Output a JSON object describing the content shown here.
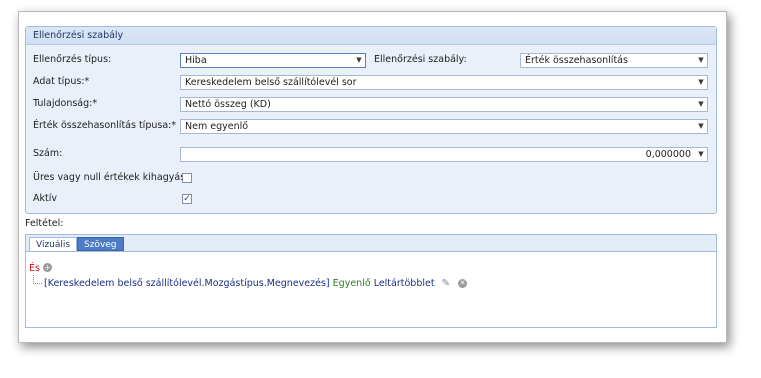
{
  "group": {
    "title": "Ellenőrzési szabály"
  },
  "form": {
    "ellenorzes_tipus": {
      "label": "Ellenőrzés típus:",
      "value": "Hiba"
    },
    "ellenorzesi_szabaly": {
      "label": "Ellenőrzési szabály:",
      "value": "Érték összehasonlítás"
    },
    "adat_tipus": {
      "label": "Adat típus:*",
      "value": "Kereskedelem belső szállítólevél sor"
    },
    "tulajdonsag": {
      "label": "Tulajdonság:*",
      "value": "Nettó összeg (KD)"
    },
    "osszehasonlitas_tipusa": {
      "label": "Érték összehasonlítás típusa:*",
      "value": "Nem egyenlő"
    },
    "szam": {
      "label": "Szám:",
      "value": "0,000000"
    },
    "ures_null": {
      "label": "Üres vagy null értékek kihagyása",
      "checked": false
    },
    "aktiv": {
      "label": "Aktív",
      "checked": true
    }
  },
  "condition": {
    "label": "Feltétel:",
    "tabs": [
      {
        "label": "Vizuális"
      },
      {
        "label": "Szöveg"
      }
    ],
    "group_operator": "És",
    "rule": {
      "field": "[Kereskedelem belső szállítólevél.Mozgástípus.Megnevezés]",
      "operator": "Egyenlő",
      "value": "Leltártöbblet"
    }
  },
  "icons": {
    "dropdown": "chevron-down-icon",
    "add": "plus-circle-icon",
    "edit": "pencil-icon",
    "remove": "close-circle-icon",
    "check": "checkmark-icon"
  },
  "colors": {
    "accent": "#4c7cc6",
    "group_bg": "#e9f0f9",
    "operator_and": "#c41818",
    "operator_equal": "#2f7d1e",
    "field_text": "#1c2f86"
  }
}
